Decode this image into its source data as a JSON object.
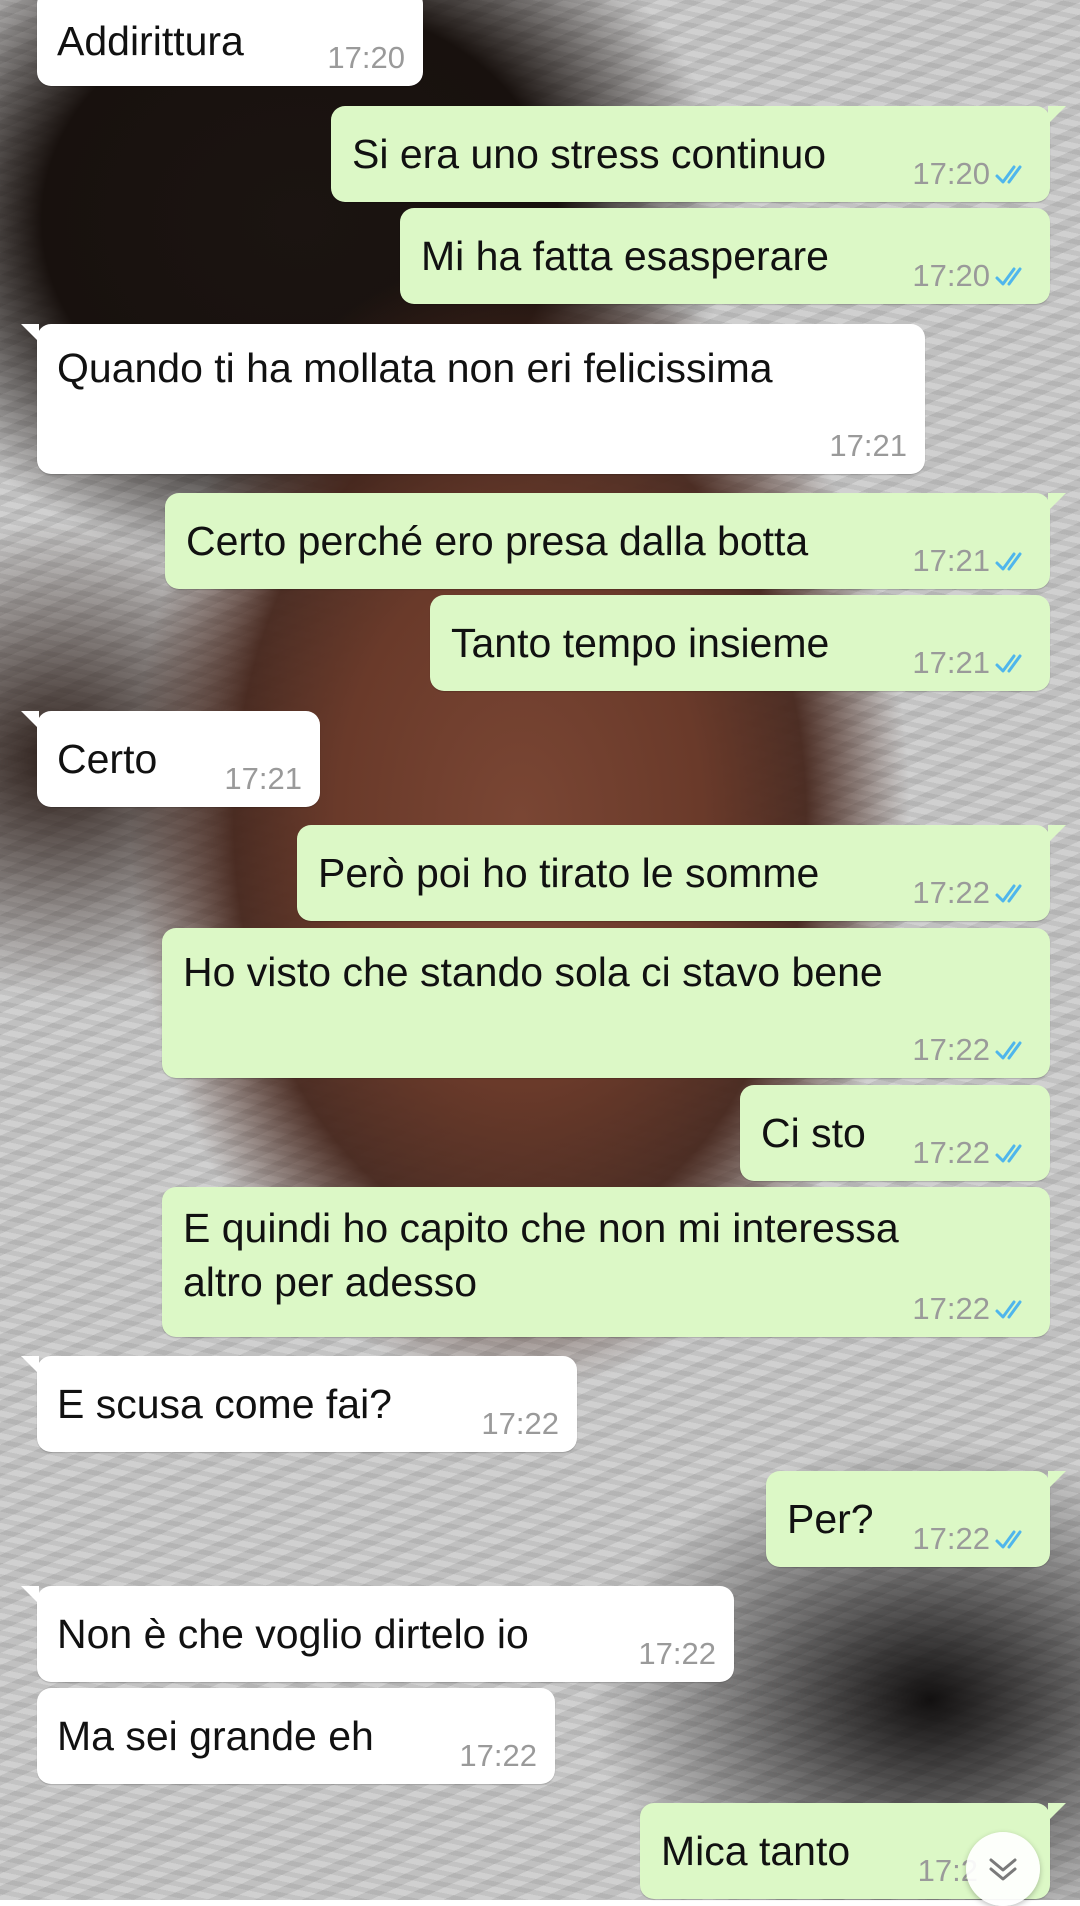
{
  "messages": [
    {
      "dir": "in",
      "text": "Addirittura",
      "time": "17:20"
    },
    {
      "dir": "out",
      "text": "Si era uno stress continuo",
      "time": "17:20"
    },
    {
      "dir": "out",
      "text": "Mi ha fatta esasperare",
      "time": "17:20"
    },
    {
      "dir": "in",
      "text": "Quando ti ha mollata non eri felicissima",
      "time": "17:21"
    },
    {
      "dir": "out",
      "text": "Certo perché ero presa dalla botta",
      "time": "17:21"
    },
    {
      "dir": "out",
      "text": "Tanto tempo insieme",
      "time": "17:21"
    },
    {
      "dir": "in",
      "text": "Certo",
      "time": "17:21"
    },
    {
      "dir": "out",
      "text": "Però poi ho tirato le somme",
      "time": "17:22"
    },
    {
      "dir": "out",
      "text": "Ho visto che stando sola ci stavo bene",
      "time": "17:22"
    },
    {
      "dir": "out",
      "text": "Ci sto",
      "time": "17:22"
    },
    {
      "dir": "out",
      "text": "E quindi ho capito che non mi interessa altro per adesso",
      "time": "17:22"
    },
    {
      "dir": "in",
      "text": "E scusa come fai?",
      "time": "17:22"
    },
    {
      "dir": "out",
      "text": "Per?",
      "time": "17:22"
    },
    {
      "dir": "in",
      "text": "Non è che voglio dirtelo io",
      "time": "17:22"
    },
    {
      "dir": "in",
      "text": "Ma sei grande eh",
      "time": "17:22"
    },
    {
      "dir": "out",
      "text": "Mica tanto",
      "time": "17:2"
    }
  ],
  "colors": {
    "incoming_bubble": "#ffffff",
    "outgoing_bubble": "#dcf8c6",
    "read_ticks": "#4fb6ec",
    "timestamp": "#9a9a9a"
  },
  "icons": {
    "read_receipt": "double-check-icon",
    "scroll_down": "chevron-down-double-icon"
  }
}
